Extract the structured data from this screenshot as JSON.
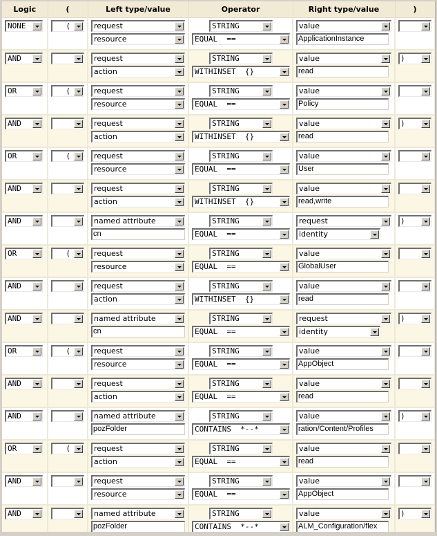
{
  "headers": {
    "logic": "Logic",
    "open_paren": "(",
    "left": "Left type/value",
    "operator": "Operator",
    "right": "Right type/value",
    "close_paren": ")"
  },
  "rows": [
    {
      "logic": "NONE",
      "open": "(",
      "left_type": "request",
      "left_kind": "select",
      "left_value": "resource",
      "op_type": "STRING",
      "op": "EQUAL  ==",
      "right_type": "value",
      "right_kind": "input",
      "right_value": "ApplicationInstance",
      "close": ""
    },
    {
      "logic": "AND",
      "open": "",
      "left_type": "request",
      "left_kind": "select",
      "left_value": "action",
      "op_type": "STRING",
      "op": "WITHINSET  {}",
      "right_type": "value",
      "right_kind": "input",
      "right_value": "read",
      "close": ")"
    },
    {
      "logic": "OR",
      "open": "(",
      "left_type": "request",
      "left_kind": "select",
      "left_value": "resource",
      "op_type": "STRING",
      "op": "EQUAL  ==",
      "right_type": "value",
      "right_kind": "input",
      "right_value": "Policy",
      "close": ""
    },
    {
      "logic": "AND",
      "open": "",
      "left_type": "request",
      "left_kind": "select",
      "left_value": "action",
      "op_type": "STRING",
      "op": "WITHINSET  {}",
      "right_type": "value",
      "right_kind": "input",
      "right_value": "read",
      "close": ")"
    },
    {
      "logic": "OR",
      "open": "(",
      "left_type": "request",
      "left_kind": "select",
      "left_value": "resource",
      "op_type": "STRING",
      "op": "EQUAL  ==",
      "right_type": "value",
      "right_kind": "input",
      "right_value": "User",
      "close": ""
    },
    {
      "logic": "AND",
      "open": "",
      "left_type": "request",
      "left_kind": "select",
      "left_value": "action",
      "op_type": "STRING",
      "op": "WITHINSET  {}",
      "right_type": "value",
      "right_kind": "input",
      "right_value": "read,write",
      "close": ""
    },
    {
      "logic": "AND",
      "open": "",
      "left_type": "named attribute",
      "left_kind": "input",
      "left_value": "cn",
      "op_type": "STRING",
      "op": "EQUAL  ==",
      "right_type": "request",
      "right_kind": "select",
      "right_value": "identity",
      "close": ")"
    },
    {
      "logic": "OR",
      "open": "(",
      "left_type": "request",
      "left_kind": "select",
      "left_value": "resource",
      "op_type": "STRING",
      "op": "EQUAL  ==",
      "right_type": "value",
      "right_kind": "input",
      "right_value": "GlobalUser",
      "close": ""
    },
    {
      "logic": "AND",
      "open": "",
      "left_type": "request",
      "left_kind": "select",
      "left_value": "action",
      "op_type": "STRING",
      "op": "WITHINSET  {}",
      "right_type": "value",
      "right_kind": "input",
      "right_value": "read",
      "close": ""
    },
    {
      "logic": "AND",
      "open": "",
      "left_type": "named attribute",
      "left_kind": "input",
      "left_value": "cn",
      "op_type": "STRING",
      "op": "EQUAL  ==",
      "right_type": "request",
      "right_kind": "select",
      "right_value": "identity",
      "close": ")"
    },
    {
      "logic": "OR",
      "open": "(",
      "left_type": "request",
      "left_kind": "select",
      "left_value": "resource",
      "op_type": "STRING",
      "op": "EQUAL  ==",
      "right_type": "value",
      "right_kind": "input",
      "right_value": "AppObject",
      "close": ""
    },
    {
      "logic": "AND",
      "open": "",
      "left_type": "request",
      "left_kind": "select",
      "left_value": "action",
      "op_type": "STRING",
      "op": "EQUAL  ==",
      "right_type": "value",
      "right_kind": "input",
      "right_value": "read",
      "close": ""
    },
    {
      "logic": "AND",
      "open": "",
      "left_type": "named attribute",
      "left_kind": "input",
      "left_value": "pozFolder",
      "op_type": "STRING",
      "op": "CONTAINS  *--*",
      "right_type": "value",
      "right_kind": "input",
      "right_value": "ration/Content/Profiles",
      "close": ")"
    },
    {
      "logic": "OR",
      "open": "(",
      "left_type": "request",
      "left_kind": "select",
      "left_value": "action",
      "op_type": "STRING",
      "op": "EQUAL  ==",
      "right_type": "value",
      "right_kind": "input",
      "right_value": "read",
      "close": ""
    },
    {
      "logic": "AND",
      "open": "",
      "left_type": "request",
      "left_kind": "select",
      "left_value": "resource",
      "op_type": "STRING",
      "op": "EQUAL  ==",
      "right_type": "value",
      "right_kind": "input",
      "right_value": "AppObject",
      "close": ""
    },
    {
      "logic": "AND",
      "open": "",
      "left_type": "named attribute",
      "left_kind": "input",
      "left_value": "pozFolder",
      "op_type": "STRING",
      "op": "CONTAINS  *--*",
      "right_type": "value",
      "right_kind": "input",
      "right_value": "ALM_Configuration/flex",
      "close": ")"
    }
  ]
}
